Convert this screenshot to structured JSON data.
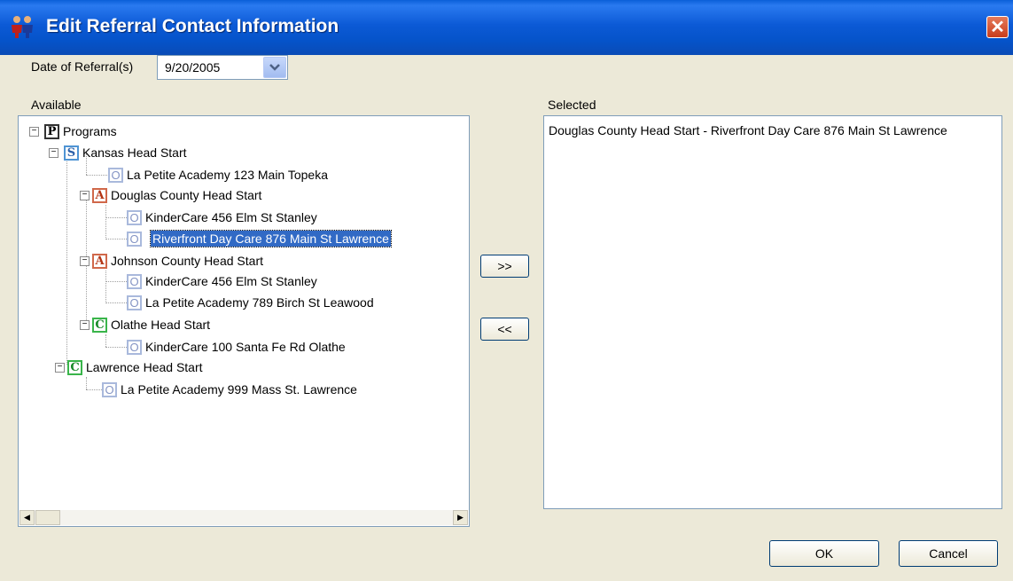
{
  "window": {
    "title": "Edit Referral Contact Information",
    "close_label": "✕",
    "app_icon": "people-icon"
  },
  "date_field": {
    "label": "Date of Referral(s)",
    "value": "9/20/2005"
  },
  "available": {
    "label": "Available",
    "tree": {
      "root": {
        "icon": "P",
        "label": "Programs"
      },
      "kansas": {
        "icon": "S",
        "label": "Kansas Head Start"
      },
      "kansas_site": {
        "icon": "O",
        "label": "La Petite Academy 123 Main Topeka"
      },
      "douglas": {
        "icon": "A",
        "label": "Douglas County Head Start"
      },
      "douglas_site1": {
        "icon": "O",
        "label": "KinderCare 456 Elm St Stanley"
      },
      "douglas_site2": {
        "icon": "O",
        "label": "Riverfront Day Care 876 Main St Lawrence",
        "selected": true
      },
      "johnson": {
        "icon": "A",
        "label": "Johnson County Head Start"
      },
      "johnson_site1": {
        "icon": "O",
        "label": "KinderCare 456 Elm St Stanley"
      },
      "johnson_site2": {
        "icon": "O",
        "label": "La Petite Academy 789 Birch St Leawood"
      },
      "olathe": {
        "icon": "C",
        "label": "Olathe Head Start"
      },
      "olathe_site": {
        "icon": "O",
        "label": "KinderCare 100 Santa Fe Rd Olathe"
      },
      "lawrence": {
        "icon": "C",
        "label": "Lawrence Head Start"
      },
      "lawrence_site": {
        "icon": "O",
        "label": "La Petite Academy 999 Mass St. Lawrence"
      }
    }
  },
  "selected": {
    "label": "Selected",
    "items": [
      "Douglas County Head Start - Riverfront Day Care 876 Main St Lawrence"
    ]
  },
  "buttons": {
    "add": ">>",
    "remove": "<<",
    "ok": "OK",
    "cancel": "Cancel"
  },
  "colors": {
    "titlebar": "#0553c9",
    "selection": "#316ac5",
    "dialog_bg": "#ece9d8"
  }
}
